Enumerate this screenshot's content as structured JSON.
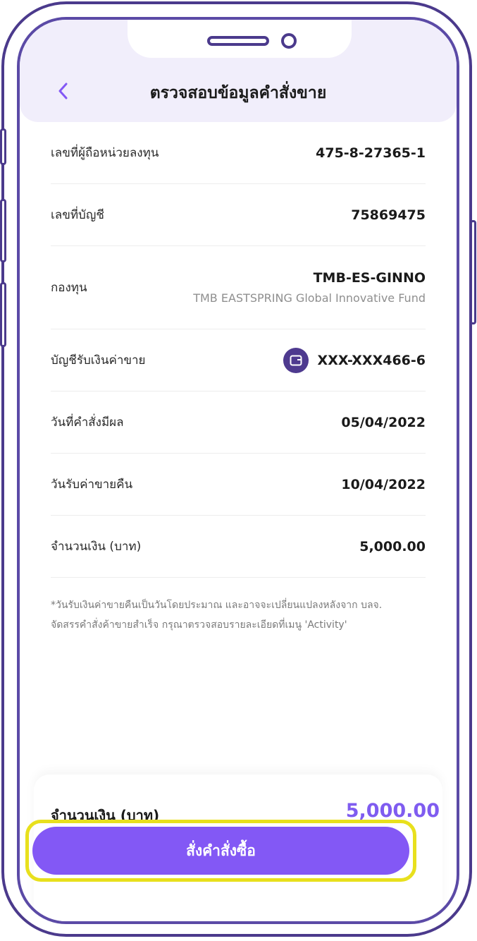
{
  "header": {
    "title": "ตรวจสอบข้อมูลคำสั่งขาย"
  },
  "rows": [
    {
      "label": "เลขที่ผู้ถือหน่วยลงทุน",
      "value": "475-8-27365-1"
    },
    {
      "label": "เลขที่บัญชี",
      "value": "75869475"
    },
    {
      "label": "กองทุน",
      "value": "TMB-ES-GINNO",
      "sub": "TMB EASTSPRING Global Innovative Fund"
    },
    {
      "label": "บัญชีรับเงินค่าขาย",
      "value": "XXX-XXX466-6",
      "icon": "wallet-icon"
    },
    {
      "label": "วันที่คำสั่งมีผล",
      "value": "05/04/2022"
    },
    {
      "label": "วันรับค่าขายคืน",
      "value": "10/04/2022"
    },
    {
      "label": "จำนวนเงิน (บาท)",
      "value": "5,000.00"
    }
  ],
  "note": {
    "line1": "*วันรับเงินค่าขายคืนเป็นวันโดยประมาณ และอาจจะเปลี่ยนแปลงหลังจาก บลจ.",
    "line2": "จัดสรรคำสั่งค้าขายสำเร็จ กรุณาตรวจสอบรายละเอียดที่เมนู 'Activity'"
  },
  "footer": {
    "total_label": "จำนวนเงิน (บาท)",
    "total_value": "5,000.00",
    "cta_label": "สั่งคำสั่งซื้อ"
  },
  "colors": {
    "accent": "#8358f5",
    "frame": "#4b3a8c",
    "header_bg": "#f1eefb",
    "highlight": "#e8e01d"
  }
}
